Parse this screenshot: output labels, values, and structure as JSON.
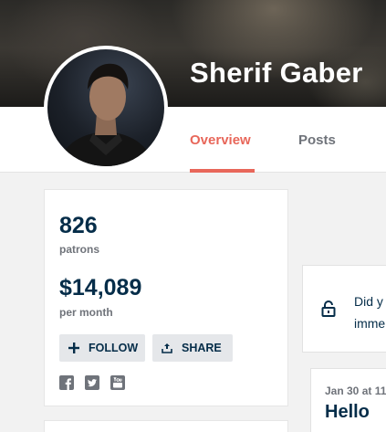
{
  "creator": {
    "name": "Sherif Gaber"
  },
  "tabs": {
    "overview": "Overview",
    "posts": "Posts"
  },
  "stats": {
    "patrons_value": "826",
    "patrons_label": "patrons",
    "earnings_value": "$14,089",
    "earnings_label": "per month"
  },
  "actions": {
    "follow": "FOLLOW",
    "share": "SHARE"
  },
  "social": [
    "facebook-icon",
    "twitter-icon",
    "youtube-icon"
  ],
  "locked_post": {
    "line1": "Did y",
    "line2": "imme"
  },
  "post": {
    "date": "Jan 30 at 11",
    "title": "Hello"
  },
  "colors": {
    "accent": "#e8675a",
    "navy": "#052d49",
    "muted": "#6f737a"
  }
}
